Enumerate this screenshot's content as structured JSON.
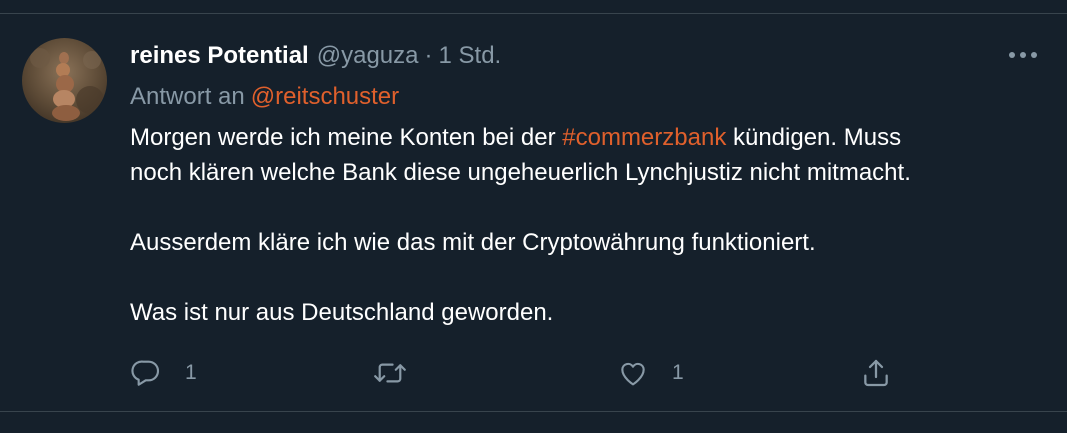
{
  "tweet": {
    "display_name": "reines Potential",
    "handle": "@yaguza",
    "separator": "·",
    "timestamp": "1 Std.",
    "reply_prefix": "Antwort an",
    "reply_to": "@reitschuster",
    "body": {
      "line1_before": "Morgen werde ich meine Konten bei der ",
      "hashtag": "#commerzbank",
      "line1_after": " kündigen. Muss",
      "line2": "noch klären welche Bank diese ungeheuerlich Lynchjustiz  nicht mitmacht.",
      "paragraph2": "Ausserdem kläre ich wie das mit der Cryptowährung funktioniert.",
      "paragraph3": "Was ist nur aus Deutschland geworden."
    }
  },
  "actions": {
    "reply_count": "1",
    "retweet_count": "",
    "like_count": "1"
  },
  "icons": {
    "more": "more-dots-icon",
    "reply": "reply-bubble-icon",
    "retweet": "retweet-icon",
    "like": "heart-icon",
    "share": "share-icon"
  },
  "colors": {
    "background": "#15202b",
    "accent": "#e0602c",
    "muted": "#8899a6",
    "divider": "#38444d",
    "text": "#ffffff"
  }
}
